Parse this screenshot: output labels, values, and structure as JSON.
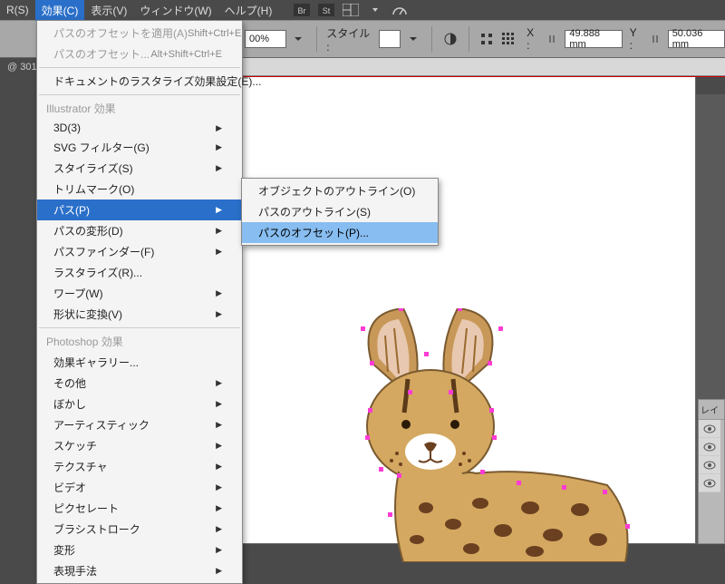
{
  "menubar": {
    "items": [
      "R(S)",
      "効果(C)",
      "表示(V)",
      "ウィンドウ(W)",
      "ヘルプ(H)"
    ],
    "active_index": 1
  },
  "toolbar": {
    "zoom": "00%",
    "style_label": "スタイル :",
    "x_label": "X :",
    "x_value": "49.888 mm",
    "y_label": "Y :",
    "y_value": "50.036 mm"
  },
  "status": "@ 301",
  "panel": {
    "tab": "レイ"
  },
  "dropdown": {
    "top_disabled": [
      {
        "label": "パスのオフセットを適用(A)",
        "shortcut": "Shift+Ctrl+E"
      },
      {
        "label": "パスのオフセット...",
        "shortcut": "Alt+Shift+Ctrl+E"
      }
    ],
    "doc_raster": "ドキュメントのラスタライズ効果設定(E)...",
    "header1": "Illustrator 効果",
    "group1": [
      {
        "label": "3D(3)",
        "arrow": true
      },
      {
        "label": "SVG フィルター(G)",
        "arrow": true
      },
      {
        "label": "スタイライズ(S)",
        "arrow": true
      },
      {
        "label": "トリムマーク(O)",
        "arrow": false
      },
      {
        "label": "パス(P)",
        "arrow": true,
        "highlight": true
      },
      {
        "label": "パスの変形(D)",
        "arrow": true
      },
      {
        "label": "パスファインダー(F)",
        "arrow": true
      },
      {
        "label": "ラスタライズ(R)...",
        "arrow": false
      },
      {
        "label": "ワープ(W)",
        "arrow": true
      },
      {
        "label": "形状に変換(V)",
        "arrow": true
      }
    ],
    "header2": "Photoshop 効果",
    "group2": [
      {
        "label": "効果ギャラリー...",
        "arrow": false
      },
      {
        "label": "その他",
        "arrow": true
      },
      {
        "label": "ぼかし",
        "arrow": true
      },
      {
        "label": "アーティスティック",
        "arrow": true
      },
      {
        "label": "スケッチ",
        "arrow": true
      },
      {
        "label": "テクスチャ",
        "arrow": true
      },
      {
        "label": "ビデオ",
        "arrow": true
      },
      {
        "label": "ピクセレート",
        "arrow": true
      },
      {
        "label": "ブラシストローク",
        "arrow": true
      },
      {
        "label": "変形",
        "arrow": true
      },
      {
        "label": "表現手法",
        "arrow": true
      }
    ]
  },
  "submenu": {
    "items": [
      {
        "label": "オブジェクトのアウトライン(O)"
      },
      {
        "label": "パスのアウトライン(S)"
      },
      {
        "label": "パスのオフセット(P)...",
        "highlight": true
      }
    ]
  }
}
